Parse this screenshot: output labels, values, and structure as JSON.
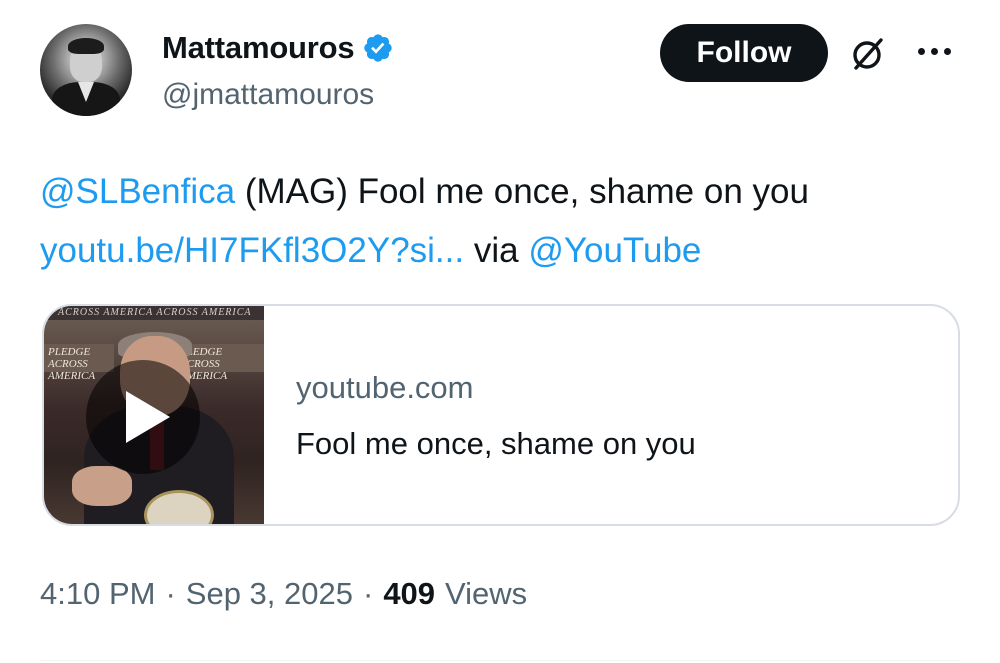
{
  "author": {
    "display_name": "Mattamouros",
    "handle": "@jmattamouros",
    "verified": true,
    "avatar_icon": "profile-photo"
  },
  "actions": {
    "follow_label": "Follow",
    "grok_icon": "grok-icon",
    "more_icon": "more-dots-icon"
  },
  "tweet": {
    "mention": "@SLBenfica",
    "text_part1": " (MAG) Fool me once, shame on you",
    "link": "youtu.be/HI7FKfl3O2Y?si...",
    "via": " via ",
    "via_mention": "@YouTube"
  },
  "card": {
    "domain": "youtube.com",
    "title": "Fool me once, shame on you",
    "thumbnail_banner": "ACROSS AMERICA   ACROSS AMERICA",
    "sign_left": "PLEDGE ACROSS AMERICA",
    "sign_right": "PLEDGE ACROSS AMERICA"
  },
  "meta": {
    "time": "4:10 PM",
    "date": "Sep 3, 2025",
    "separator": "·",
    "views_count": "409",
    "views_label": "Views"
  },
  "colors": {
    "link": "#1d9bf0",
    "secondary_text": "#536471",
    "primary_text": "#0f1419",
    "verified_badge": "#1d9bf0"
  }
}
